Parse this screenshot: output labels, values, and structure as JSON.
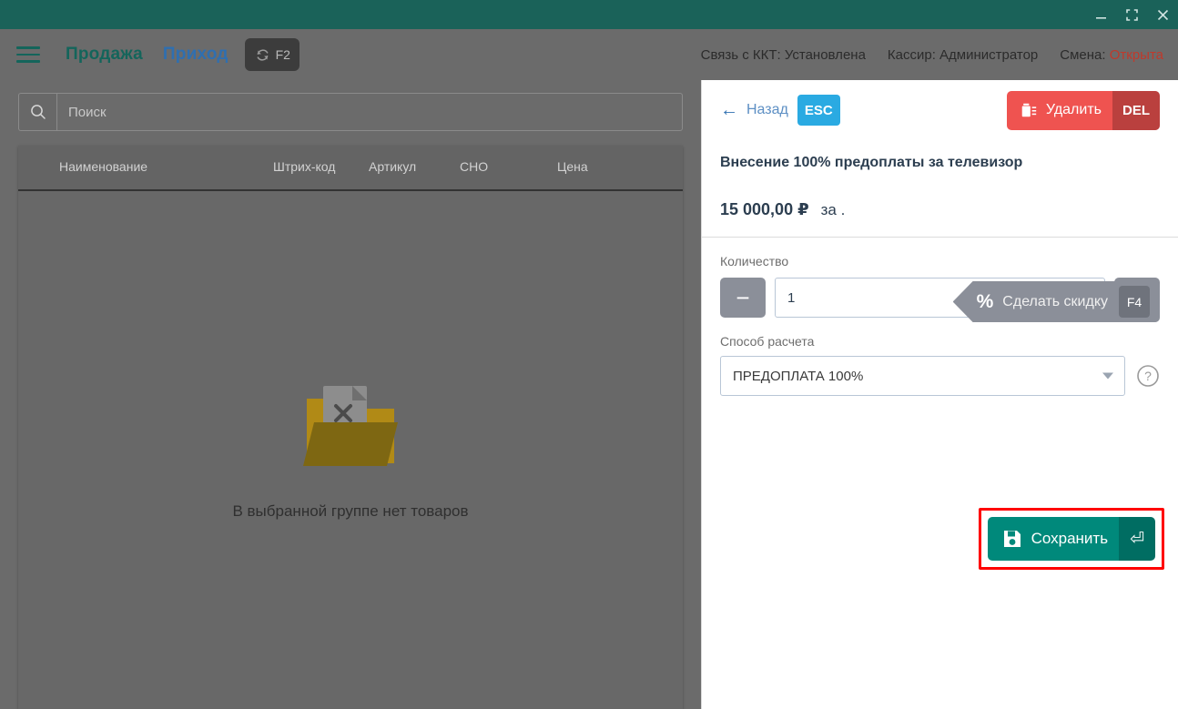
{
  "window": {
    "controls": [
      {
        "name": "minimize",
        "glyph": "minimize-icon"
      },
      {
        "name": "maximize",
        "glyph": "maximize-icon"
      },
      {
        "name": "close",
        "glyph": "close-icon"
      }
    ]
  },
  "appbar": {
    "menu_icon": "hamburger-menu-icon",
    "nav_sale": "Продажа",
    "nav_income": "Приход",
    "refresh": {
      "icon": "refresh-icon",
      "key": "F2"
    },
    "status": {
      "kkt": "Связь с ККТ: Установлена",
      "cashier": "Кассир: Администратор",
      "shift_label": "Смена:",
      "shift_value": "Открыта",
      "shift_color": "#c0392b"
    }
  },
  "left": {
    "search": {
      "icon": "search-icon",
      "placeholder": "Поиск",
      "value": ""
    },
    "table": {
      "columns": [
        "Наименование",
        "Штрих-код",
        "Артикул",
        "СНО",
        "Цена"
      ],
      "rows": [],
      "empty_icon": "empty-folder-icon",
      "empty_text": "В выбранной группе нет товаров"
    }
  },
  "right": {
    "back": {
      "icon": "arrow-left-icon",
      "label": "Назад",
      "key": "ESC"
    },
    "delete": {
      "icon": "trash-icon",
      "label": "Удалить",
      "key": "DEL",
      "color": "#ef5350"
    },
    "item_title": "Внесение 100% предоплаты за телевизор",
    "price": "15 000,00 ₽",
    "price_unit": "за .",
    "discount": {
      "icon": "percent-icon",
      "label": "Сделать скидку",
      "key": "F4"
    },
    "quantity": {
      "label": "Количество",
      "value": "1",
      "minus": "−",
      "plus": "+"
    },
    "calc_method": {
      "label": "Способ расчета",
      "value": "ПРЕДОПЛАТА 100%",
      "options": [
        "ПРЕДОПЛАТА 100%"
      ],
      "help_icon": "help-circle-icon"
    },
    "save": {
      "icon": "save-icon",
      "label": "Сохранить",
      "key": "⏎",
      "color": "#00897b",
      "highlight_color": "#ff0000"
    }
  }
}
